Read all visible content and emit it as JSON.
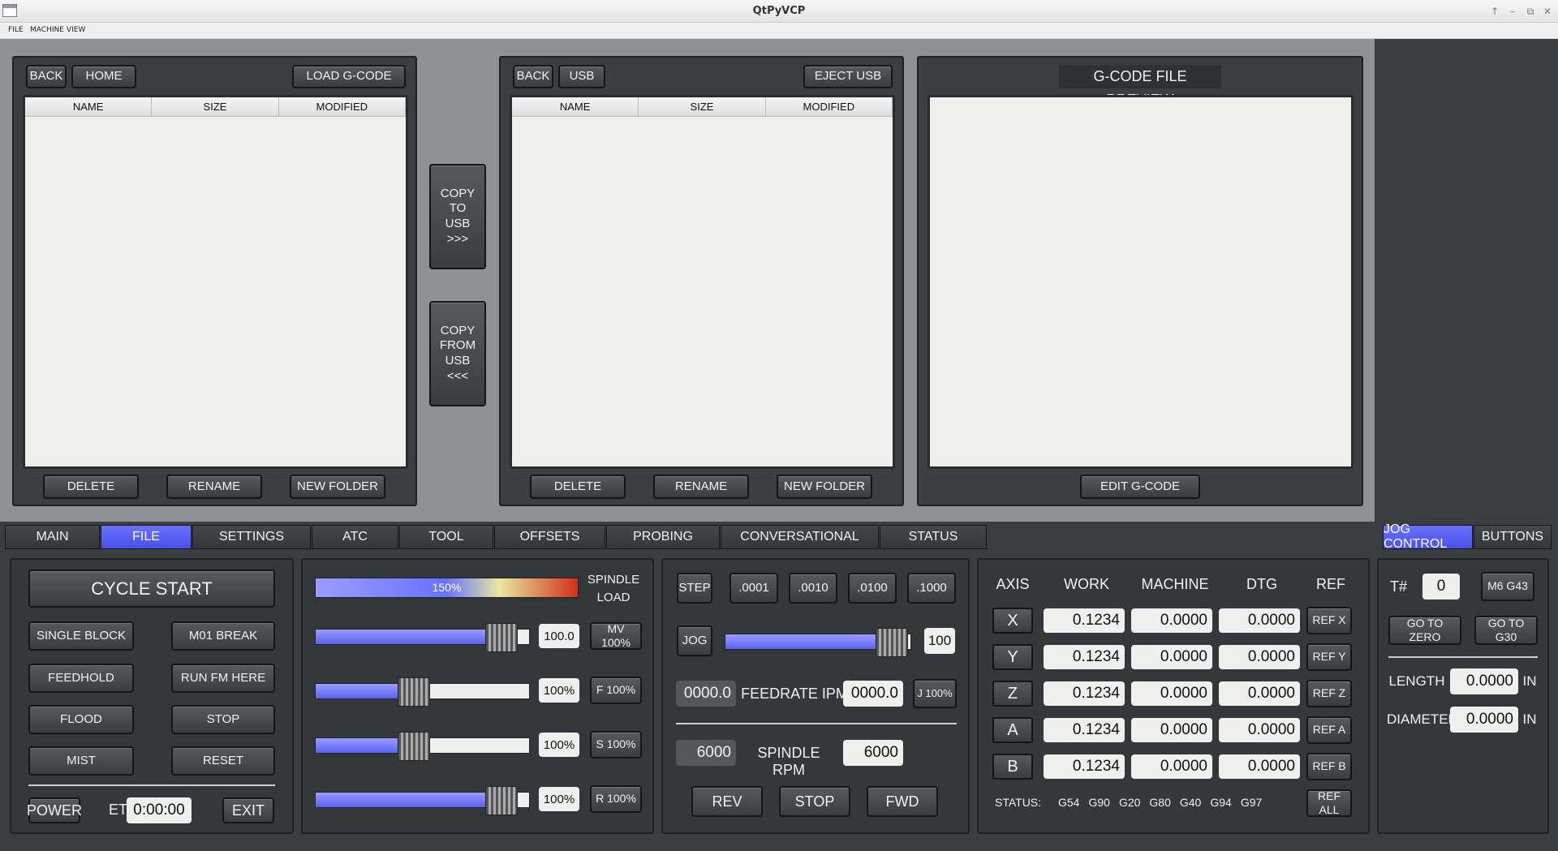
{
  "window": {
    "title": "QtPyVCP"
  },
  "menubar": {
    "items": [
      "FILE",
      "MACHINE",
      "VIEW"
    ]
  },
  "file_panel_left": {
    "back": "BACK",
    "home": "HOME",
    "load": "LOAD G-CODE",
    "columns": [
      "NAME",
      "SIZE",
      "MODIFIED"
    ],
    "delete": "DELETE",
    "rename": "RENAME",
    "new_folder": "NEW FOLDER"
  },
  "copy_buttons": {
    "to_usb": [
      "COPY",
      "TO",
      "USB",
      ">>>"
    ],
    "from_usb": [
      "COPY",
      "FROM",
      "USB",
      "<<<"
    ]
  },
  "file_panel_usb": {
    "back": "BACK",
    "usb": "USB",
    "eject": "EJECT USB",
    "columns": [
      "NAME",
      "SIZE",
      "MODIFIED"
    ],
    "delete": "DELETE",
    "rename": "RENAME",
    "new_folder": "NEW FOLDER"
  },
  "preview": {
    "title": "G-CODE FILE PREVIEW",
    "edit": "EDIT G-CODE"
  },
  "tabs": [
    "MAIN",
    "FILE",
    "SETTINGS",
    "ATC",
    "TOOL",
    "OFFSETS",
    "PROBING",
    "CONVERSATIONAL",
    "STATUS"
  ],
  "active_tab": "FILE",
  "side_tabs": [
    "JOG CONTROL",
    "BUTTONS"
  ],
  "controls": {
    "cycle_start": "CYCLE START",
    "single_block": "SINGLE BLOCK",
    "m01_break": "M01 BREAK",
    "feedhold": "FEEDHOLD",
    "run_from_here": "RUN FM HERE",
    "flood": "FLOOD",
    "stop": "STOP",
    "mist": "MIST",
    "reset": "RESET",
    "power": "POWER",
    "et_label": "ET",
    "et_value": "0:00:00",
    "exit": "EXIT"
  },
  "overrides": {
    "spindle_load_bar": "150%",
    "spindle_load_fraction": 0.67,
    "spindle_load_label": [
      "SPINDLE",
      "LOAD"
    ],
    "rows": [
      {
        "value": "100.0",
        "button": "MV 100%",
        "fraction": 0.87
      },
      {
        "value": "100%",
        "button": "F 100%",
        "fraction": 0.46
      },
      {
        "value": "100%",
        "button": "S 100%",
        "fraction": 0.46
      },
      {
        "value": "100%",
        "button": "R 100%",
        "fraction": 0.87
      }
    ]
  },
  "jog": {
    "step": "STEP",
    "increments": [
      ".0001",
      ".0010",
      ".0100",
      ".1000"
    ],
    "jog": "JOG",
    "jog_value": "100",
    "jog_fraction": 0.9,
    "feed_actual": "0000.0",
    "feed_label": "FEEDRATE IPM",
    "feed_set": "0000.0",
    "j_override": "J 100%",
    "spindle_actual": "6000",
    "spindle_label": "SPINDLE RPM",
    "spindle_set": "6000",
    "rev": "REV",
    "stop": "STOP",
    "fwd": "FWD"
  },
  "dro": {
    "headers": [
      "AXIS",
      "WORK",
      "MACHINE",
      "DTG",
      "REF"
    ],
    "axes": [
      {
        "axis": "X",
        "work": "0.1234",
        "machine": "0.0000",
        "dtg": "0.0000",
        "ref": "REF X"
      },
      {
        "axis": "Y",
        "work": "0.1234",
        "machine": "0.0000",
        "dtg": "0.0000",
        "ref": "REF Y"
      },
      {
        "axis": "Z",
        "work": "0.1234",
        "machine": "0.0000",
        "dtg": "0.0000",
        "ref": "REF Z"
      },
      {
        "axis": "A",
        "work": "0.1234",
        "machine": "0.0000",
        "dtg": "0.0000",
        "ref": "REF A"
      },
      {
        "axis": "B",
        "work": "0.1234",
        "machine": "0.0000",
        "dtg": "0.0000",
        "ref": "REF B"
      }
    ],
    "status_label": "STATUS:",
    "gcodes": [
      "G54",
      "G90",
      "G20",
      "G80",
      "G40",
      "G94",
      "G97"
    ],
    "ref_all": "REF ALL"
  },
  "tool": {
    "tnum_label": "T#",
    "tnum": "0",
    "m6g43": "M6 G43",
    "go_zero": "GO TO ZERO",
    "go_g30": "GO TO G30",
    "length_label": "LENGTH",
    "length": "0.0000",
    "length_unit": "IN",
    "diameter_label": "DIAMETER",
    "diameter": "0.0000",
    "diameter_unit": "IN"
  }
}
